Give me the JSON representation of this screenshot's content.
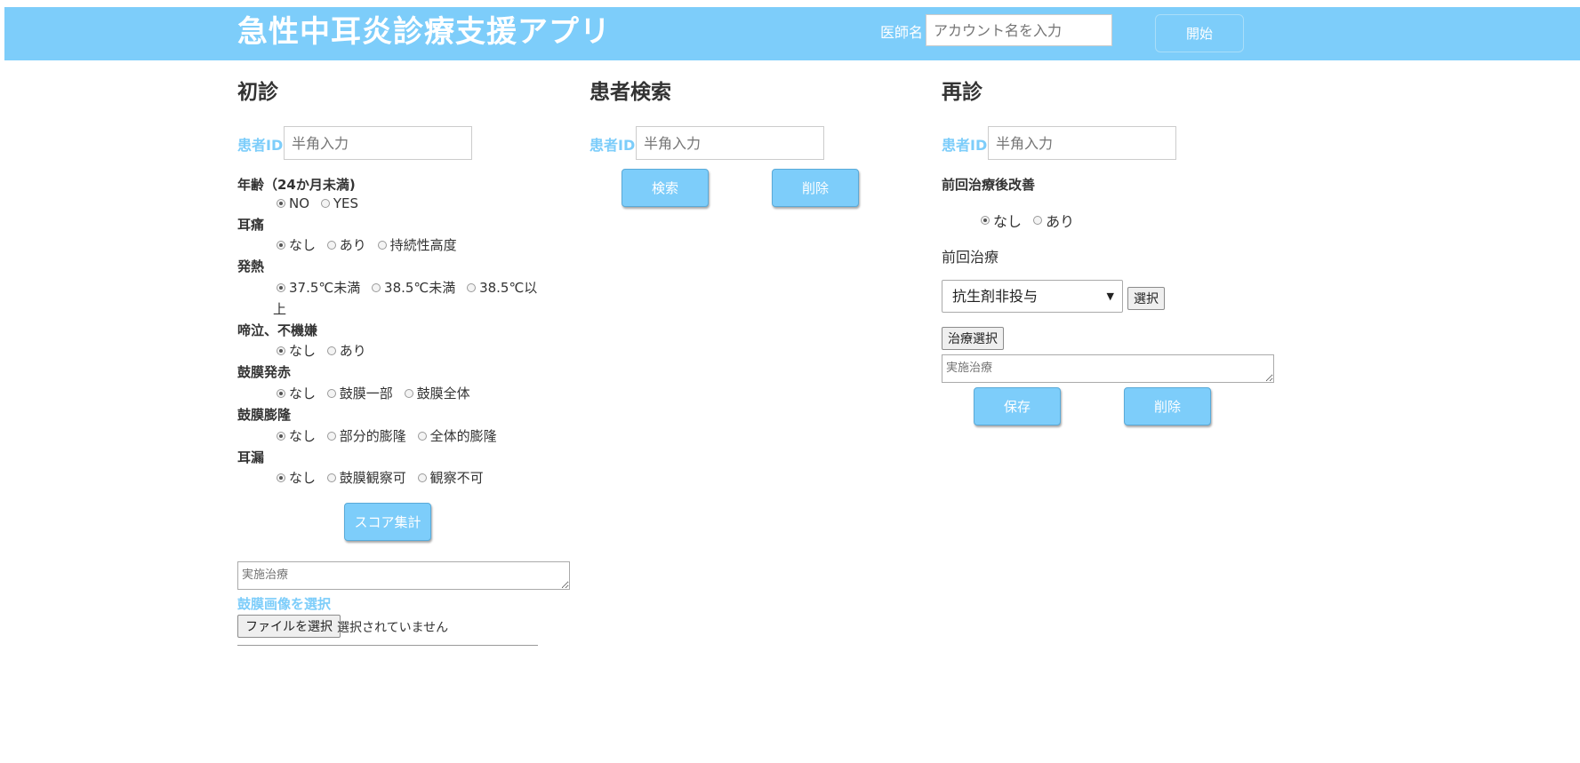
{
  "header": {
    "title": "急性中耳炎診療支援アプリ",
    "doctor_label": "医師名",
    "account_placeholder": "アカウント名を入力",
    "start_label": "開始"
  },
  "first_visit": {
    "title": "初診",
    "patient_id_label": "患者ID",
    "patient_id_placeholder": "半角入力",
    "questions": [
      {
        "label": "年齢（24か月未満)",
        "options": [
          "NO",
          "YES"
        ],
        "selected": 0
      },
      {
        "label": "耳痛",
        "options": [
          "なし",
          "あり",
          "持続性高度"
        ],
        "selected": 0
      },
      {
        "label": "発熱",
        "options": [
          "37.5℃未満",
          "38.5℃未満",
          "38.5℃以"
        ],
        "wrap": "上",
        "selected": 0
      },
      {
        "label": "啼泣、不機嫌",
        "options": [
          "なし",
          "あり"
        ],
        "selected": 0
      },
      {
        "label": "鼓膜発赤",
        "options": [
          "なし",
          "鼓膜一部",
          "鼓膜全体"
        ],
        "selected": 0
      },
      {
        "label": "鼓膜膨隆",
        "options": [
          "なし",
          "部分的膨隆",
          "全体的膨隆"
        ],
        "selected": 0
      },
      {
        "label": "耳漏",
        "options": [
          "なし",
          " 鼓膜観察可",
          "観察不可"
        ],
        "selected": 0
      }
    ],
    "score_button": "スコア集計",
    "treatment_placeholder": "実施治療",
    "image_label": "鼓膜画像を選択",
    "file_button": "ファイルを選択",
    "file_status": "選択されていません"
  },
  "search": {
    "title": "患者検索",
    "patient_id_label": "患者ID",
    "patient_id_placeholder": "半角入力",
    "search_button": "検索",
    "delete_button": "削除"
  },
  "revisit": {
    "title": "再診",
    "patient_id_label": "患者ID",
    "patient_id_placeholder": "半角入力",
    "improvement_label": "前回治療後改善",
    "improvement_options": [
      "なし",
      "あり"
    ],
    "improvement_selected": 0,
    "prev_treatment_label": "前回治療",
    "prev_treatment_value": "抗生剤非投与",
    "select_button": "選択",
    "treatment_select_button": "治療選択",
    "treatment_placeholder": "実施治療",
    "save_button": "保存",
    "delete_button": "削除"
  },
  "colors": {
    "accent": "#7dcdfa"
  }
}
